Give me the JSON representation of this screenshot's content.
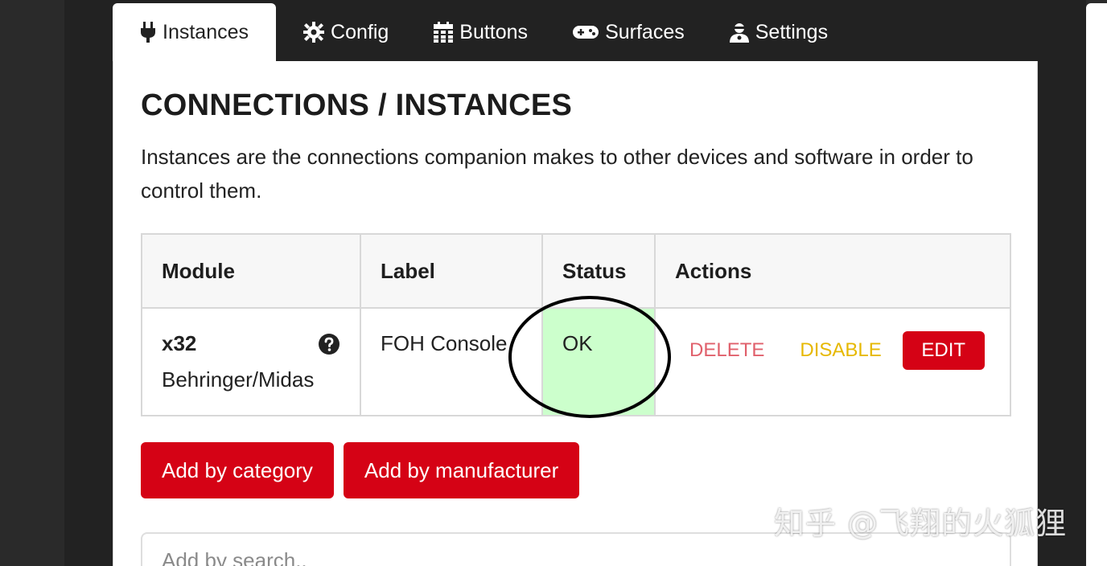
{
  "tabs": [
    {
      "label": "Instances",
      "icon": "plug-icon",
      "active": true
    },
    {
      "label": "Config",
      "icon": "gear-icon"
    },
    {
      "label": "Buttons",
      "icon": "calendar-grid-icon"
    },
    {
      "label": "Surfaces",
      "icon": "gamepad-icon"
    },
    {
      "label": "Settings",
      "icon": "user-cog-icon"
    }
  ],
  "page": {
    "title": "CONNECTIONS / INSTANCES",
    "description": "Instances are the connections companion makes to other devices and software in order to control them."
  },
  "table": {
    "headers": [
      "Module",
      "Label",
      "Status",
      "Actions"
    ],
    "rows": [
      {
        "module": "x32",
        "module_sub": "Behringer/Midas",
        "label": "FOH Console",
        "status": "OK",
        "actions": {
          "delete": "DELETE",
          "disable": "DISABLE",
          "edit": "EDIT"
        }
      }
    ]
  },
  "buttons": {
    "add_category": "Add by category",
    "add_manufacturer": "Add by manufacturer"
  },
  "search": {
    "placeholder": "Add by search.."
  },
  "watermark": "知乎 @飞翔的火狐狸",
  "colors": {
    "accent": "#d50215",
    "status_ok": "#ccffcc",
    "delete": "#e0606b",
    "disable": "#e6b800"
  }
}
